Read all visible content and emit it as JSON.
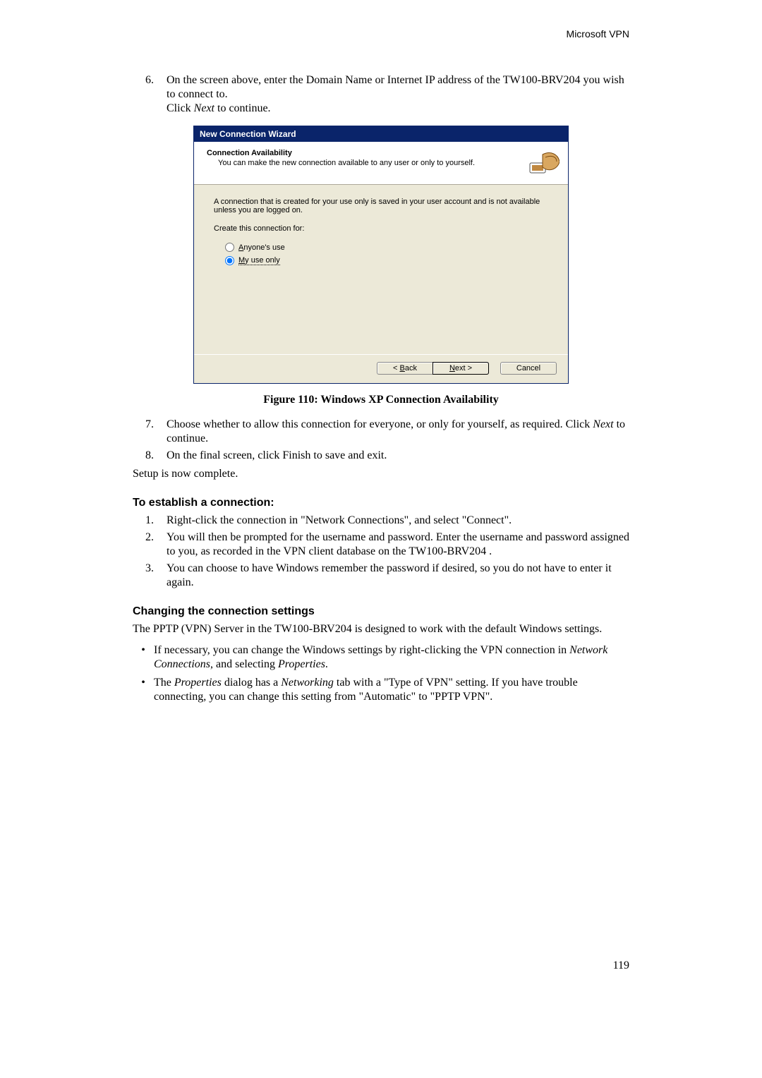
{
  "header": {
    "right": "Microsoft VPN"
  },
  "step6": {
    "num": "6.",
    "text_before_italic": "On the screen above, enter the Domain Name or Internet IP address of the TW100-BRV204  you wish to connect to.",
    "click": "Click ",
    "italic": "Next",
    "after": " to continue."
  },
  "wizard": {
    "title": "New Connection Wizard",
    "header_title": "Connection Availability",
    "header_sub": "You can make the new connection available to any user or only to yourself.",
    "body_para": "A connection that is created for your use only is saved in your user account and is not available unless you are logged on.",
    "create_label": "Create this connection for:",
    "radio_anyone_prefix": "A",
    "radio_anyone_rest": "nyone's use",
    "radio_myuse_prefix": "M",
    "radio_myuse_rest": "y use only",
    "btn_back_prefix": "< ",
    "btn_back_u": "B",
    "btn_back_rest": "ack",
    "btn_next_u": "N",
    "btn_next_rest": "ext >",
    "btn_cancel": "Cancel"
  },
  "figure": {
    "caption": "Figure 110: Windows XP Connection Availability"
  },
  "step7": {
    "num": "7.",
    "text_before": "Choose whether to allow this connection for everyone, or only for yourself, as required. Click ",
    "italic": "Next",
    "after": " to continue."
  },
  "step8": {
    "num": "8.",
    "text": "On the final screen, click Finish to save and exit."
  },
  "setup_complete": "Setup is now complete.",
  "heading_establish": "To establish a connection:",
  "est1": {
    "num": "1.",
    "text": "Right-click the connection in \"Network Connections\", and select \"Connect\"."
  },
  "est2": {
    "num": "2.",
    "text": "You will then be prompted for the username and password. Enter the username and password assigned to you, as recorded in the VPN client database on the TW100-BRV204 ."
  },
  "est3": {
    "num": "3.",
    "text": "You can choose to have Windows remember the password if desired, so you do not have to enter it again."
  },
  "heading_change": "Changing the connection settings",
  "change_para": "The PPTP (VPN) Server in the TW100-BRV204  is designed to work with the default Windows settings.",
  "cb1": {
    "t1": "If necessary, you can change the Windows settings by right-clicking the VPN connection in ",
    "i1": "Network Connections",
    "t2": ", and selecting ",
    "i2": "Properties",
    "t3": "."
  },
  "cb2": {
    "t0": "The ",
    "i1": "Properties",
    "t1": " dialog has a ",
    "i2": "Networking",
    "t2": " tab with a \"Type of VPN\" setting. If you have trouble connecting, you can change this setting from \"Automatic\" to \"PPTP VPN\"."
  },
  "page_number": "119"
}
